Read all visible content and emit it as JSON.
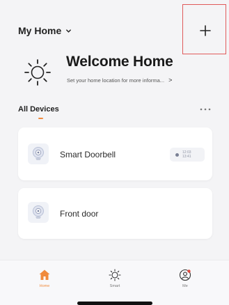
{
  "header": {
    "home_name": "My Home",
    "add_icon": "plus-icon"
  },
  "welcome": {
    "title": "Welcome Home",
    "subtitle": "Set your home location for more informa...",
    "subtitle_arrow": ">",
    "icon": "sun-icon"
  },
  "devices": {
    "section_title": "All Devices",
    "more_icon": "more-dots-icon",
    "items": [
      {
        "name": "Smart Doorbell",
        "status_time_1": "12:03",
        "status_time_2": "13:41"
      },
      {
        "name": "Front door"
      }
    ]
  },
  "tabbar": {
    "items": [
      {
        "label": "Home",
        "icon": "home-icon",
        "active": true
      },
      {
        "label": "Smart",
        "icon": "smart-sun-icon",
        "active": false
      },
      {
        "label": "Me",
        "icon": "profile-icon",
        "active": false
      }
    ]
  },
  "colors": {
    "accent": "#f08a3c",
    "background": "#f4f4f6",
    "card": "#ffffff",
    "highlight_box": "#e05a5a"
  }
}
